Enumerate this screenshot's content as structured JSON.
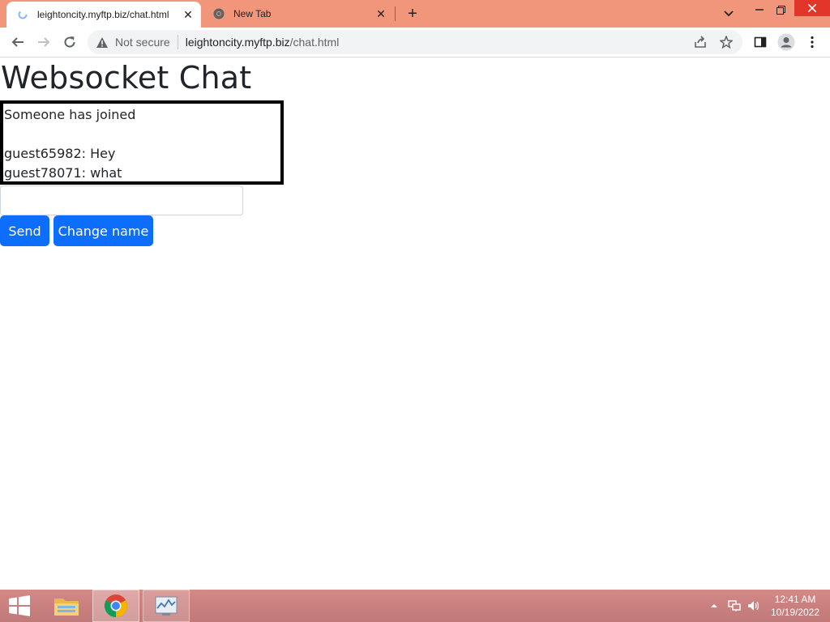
{
  "browser": {
    "tabs": [
      {
        "title": "leightoncity.myftp.biz/chat.html",
        "active": true
      },
      {
        "title": "New Tab",
        "active": false
      }
    ],
    "new_tab_label": "+",
    "omnibox": {
      "security_label": "Not secure",
      "url_host": "leightoncity.myftp.biz",
      "url_path": "/chat.html"
    }
  },
  "page": {
    "heading": "Websocket Chat",
    "messages": [
      "Someone has joined",
      "",
      "guest65982: Hey",
      "guest78071: what"
    ],
    "message_input": {
      "value": "",
      "placeholder": ""
    },
    "send_label": "Send",
    "change_name_label": "Change name",
    "accent_color": "#0d6efd"
  },
  "taskbar": {
    "time": "12:41 AM",
    "date": "10/19/2022",
    "color": "#c9807f"
  },
  "chrome": {
    "titlebar_color": "#f1967a"
  }
}
